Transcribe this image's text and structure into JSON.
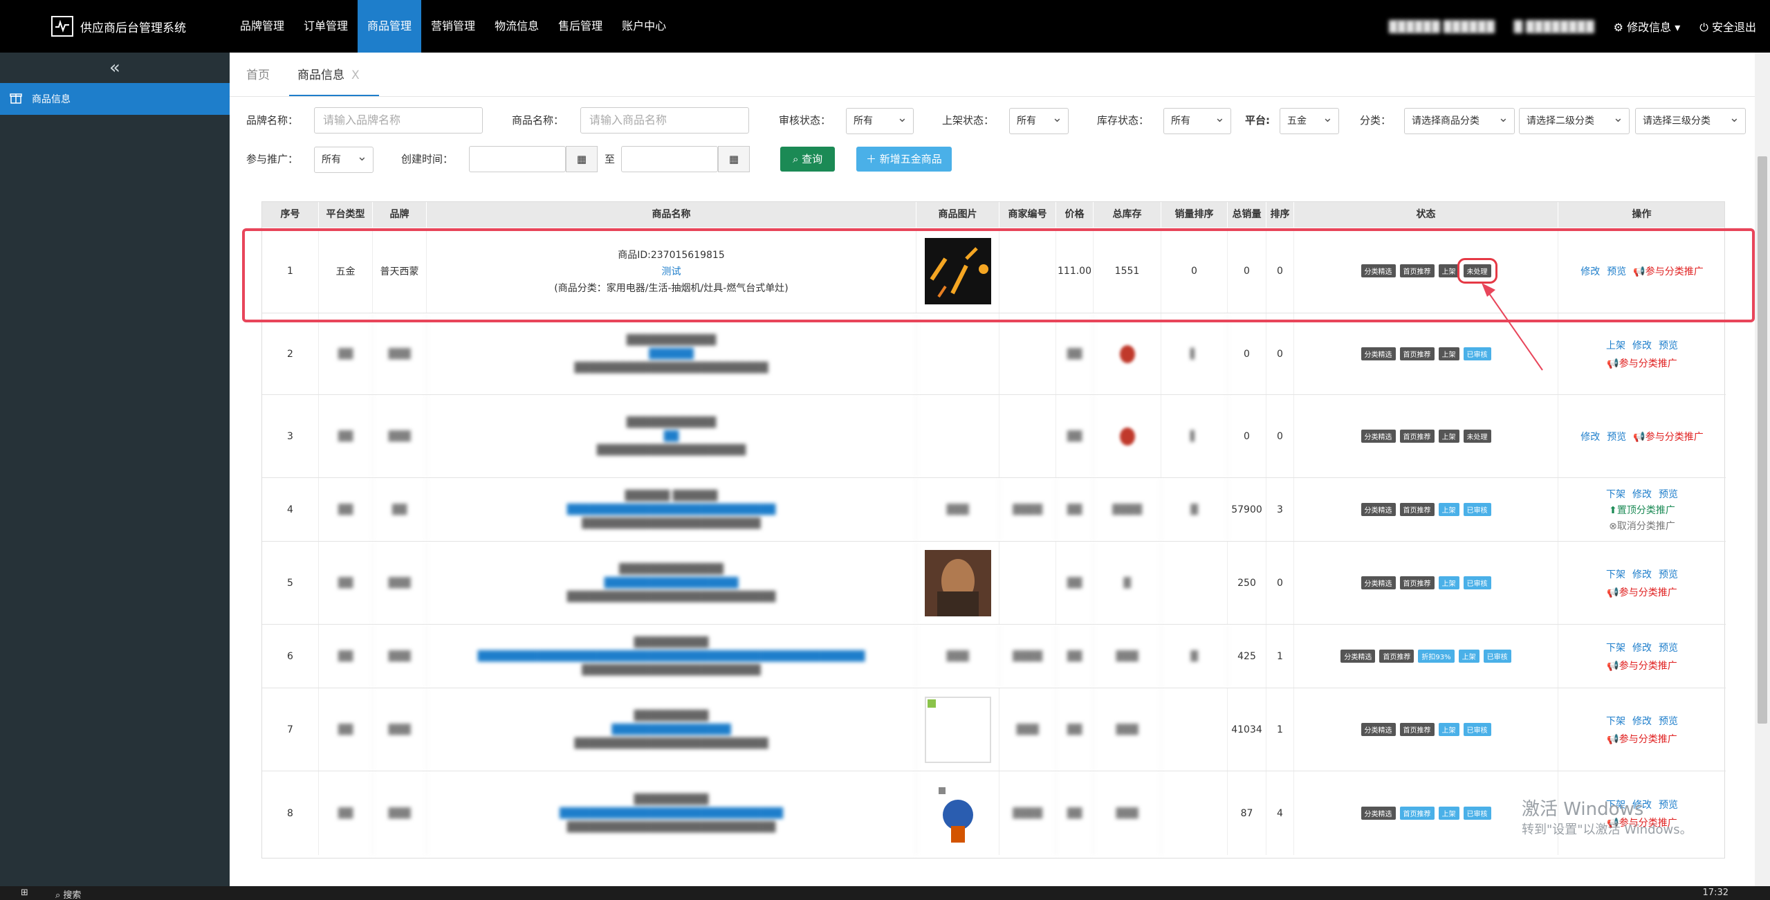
{
  "app": {
    "title": "供应商后台管理系统"
  },
  "nav": {
    "items": [
      "品牌管理",
      "订单管理",
      "商品管理",
      "营销管理",
      "物流信息",
      "售后管理",
      "账户中心"
    ],
    "active": "商品管理"
  },
  "topright": {
    "user1": "██████ ██████",
    "user2": "█ ████████",
    "edit_info": "修改信息",
    "logout": "安全退出"
  },
  "sidebar": {
    "collapse": "«",
    "item": "商品信息"
  },
  "tabs": {
    "home": "首页",
    "current": "商品信息",
    "close": "X"
  },
  "filters": {
    "brand_label": "品牌名称：",
    "brand_placeholder": "请输入品牌名称",
    "product_label": "商品名称：",
    "product_placeholder": "请输入商品名称",
    "audit_label": "审核状态：",
    "audit_value": "所有",
    "shelf_label": "上架状态：",
    "shelf_value": "所有",
    "stock_label": "库存状态：",
    "stock_value": "所有",
    "platform_label": "平台:",
    "platform_value": "五金",
    "category_label": "分类：",
    "cat1": "请选择商品分类",
    "cat2": "请选择二级分类",
    "cat3": "请选择三级分类",
    "promo_label": "参与推广：",
    "promo_value": "所有",
    "created_label": "创建时间：",
    "to": "至",
    "query_btn": "查询",
    "add_btn": "新增五金商品"
  },
  "table": {
    "headers": [
      "序号",
      "平台类型",
      "品牌",
      "商品名称",
      "商品图片",
      "商家编号",
      "价格",
      "总库存",
      "销量排序",
      "总销量",
      "排序",
      "状态",
      "操作"
    ],
    "row1": {
      "index": "1",
      "platform": "五金",
      "brand": "普天西蒙",
      "id_line": "商品ID:237015619815",
      "name": "测试",
      "category": "(商品分类：家用电器/生活-抽烟机/灶具-燃气台式单灶)",
      "price": "111.00",
      "stock": "1551",
      "sales_rank": "0",
      "sales": "0",
      "sort": "0",
      "badges": [
        "分类精选",
        "首页推荐",
        "上架",
        "未处理"
      ],
      "ops": [
        "修改",
        "预览",
        "参与分类推广"
      ]
    },
    "rows": [
      {
        "index": "2",
        "sales": "0",
        "sort": "0",
        "badges": [
          "分类精选",
          "首页推荐",
          "上架",
          "已审核"
        ],
        "ops1": [
          "上架",
          "修改",
          "预览"
        ],
        "ops2": "参与分类推广"
      },
      {
        "index": "3",
        "sales": "0",
        "sort": "0",
        "badges": [
          "分类精选",
          "首页推荐",
          "上架",
          "未处理"
        ],
        "ops1": [
          "修改",
          "预览"
        ],
        "ops2": "参与分类推广"
      },
      {
        "index": "4",
        "sales": "57900",
        "sort": "3",
        "badges": [
          "分类精选",
          "首页推荐",
          "上架",
          "已审核"
        ],
        "ops1": [
          "下架",
          "修改",
          "预览"
        ],
        "ops2": "置顶分类推广",
        "ops3": "取消分类推广"
      },
      {
        "index": "5",
        "sales": "250",
        "sort": "0",
        "badges": [
          "分类精选",
          "首页推荐",
          "上架",
          "已审核"
        ],
        "ops1": [
          "下架",
          "修改",
          "预览"
        ],
        "ops2": "参与分类推广"
      },
      {
        "index": "6",
        "sales": "425",
        "sort": "1",
        "badges": [
          "分类精选",
          "首页推荐",
          "折扣93%",
          "上架",
          "已审核"
        ],
        "ops1": [
          "下架",
          "修改",
          "预览"
        ],
        "ops2": "参与分类推广"
      },
      {
        "index": "7",
        "sales": "41034",
        "sort": "1",
        "badges": [
          "分类精选",
          "首页推荐",
          "上架",
          "已审核"
        ],
        "ops1": [
          "下架",
          "修改",
          "预览"
        ],
        "ops2": "参与分类推广"
      },
      {
        "index": "8",
        "sales": "87",
        "sort": "4",
        "badges": [
          "分类精选",
          "首页推荐",
          "上架",
          "已审核"
        ],
        "ops1": [
          "下架",
          "修改",
          "预览"
        ],
        "ops2": "参与分类推广"
      }
    ]
  },
  "watermark": {
    "line1": "激活 Windows",
    "line2": "转到\"设置\"以激活 Windows。"
  },
  "taskbar": {
    "search": "搜索",
    "time": "17:32"
  },
  "colors": {
    "topbar": "#000000",
    "accent": "#1e7ecb",
    "sidebar": "#263238",
    "highlight": "#e8455a"
  }
}
